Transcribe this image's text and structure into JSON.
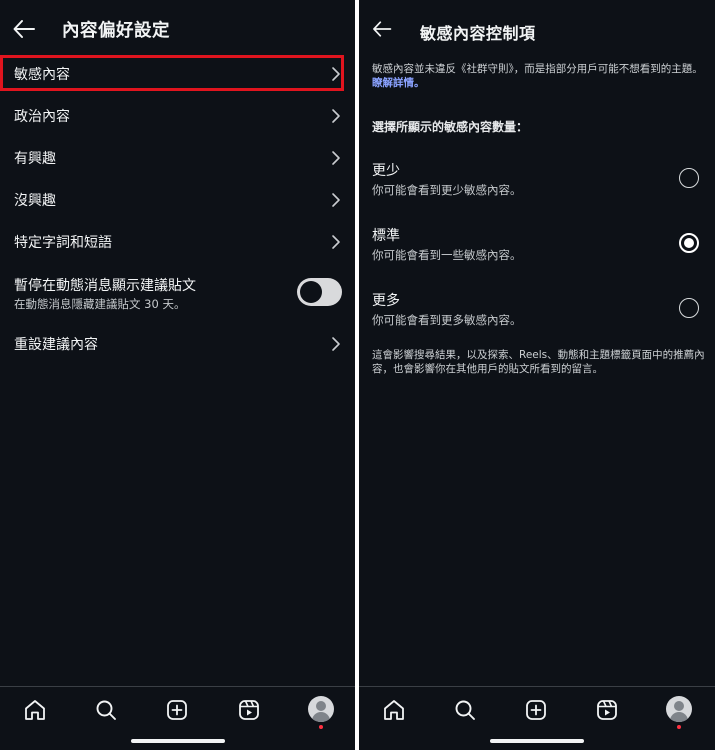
{
  "left_panel": {
    "title": "內容偏好設定",
    "items": [
      {
        "label": "敏感內容"
      },
      {
        "label": "政治內容"
      },
      {
        "label": "有興趣"
      },
      {
        "label": "沒興趣"
      },
      {
        "label": "特定字詞和短語"
      }
    ],
    "toggle_item": {
      "label": "暫停在動態消息顯示建議貼文",
      "sublabel": "在動態消息隱藏建議貼文 30 天。",
      "enabled": false
    },
    "reset_item": {
      "label": "重設建議內容"
    },
    "highlight_color": "#e0141e"
  },
  "right_panel": {
    "title": "敏感內容控制項",
    "intro_text": "敏感內容並未違反《社群守則》，而是指部分用戶可能不想看到的主題。",
    "learn_more": "瞭解詳情。",
    "section_title": "選擇所顯示的敏感內容數量：",
    "options": [
      {
        "label": "更少",
        "description": "你可能會看到更少敏感內容。",
        "selected": false
      },
      {
        "label": "標準",
        "description": "你可能會看到一些敏感內容。",
        "selected": true
      },
      {
        "label": "更多",
        "description": "你可能會看到更多敏感內容。",
        "selected": false
      }
    ],
    "footnote": "這會影響搜尋結果，以及探索、Reels、動態和主題標籤頁面中的推薦內容，也會影響你在其他用戶的貼文所看到的留言。"
  },
  "bottom_nav": {
    "icons": [
      "home-icon",
      "search-icon",
      "create-icon",
      "reels-icon",
      "profile-avatar"
    ]
  },
  "colors": {
    "background": "#0d1117",
    "text": "#f2f4f5",
    "link": "#8aa2ff",
    "notification": "#ff3040"
  }
}
